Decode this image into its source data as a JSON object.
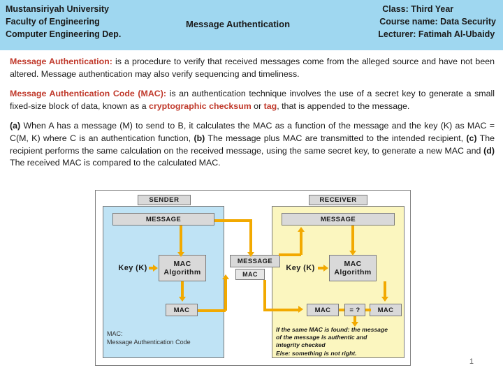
{
  "header": {
    "institution_line1": "Mustansiriyah University",
    "institution_line2": "Faculty of Engineering",
    "institution_line3": "Computer Engineering Dep.",
    "center_title": "Message Authentication",
    "class": "Class: Third Year",
    "course": "Course name: Data Security",
    "lecturer": "Lecturer: Fatimah Al-Ubaidy",
    "background_color": "#9fd7f0"
  },
  "content": {
    "para1": {
      "lead": "Message Authentication:",
      "text": " is a procedure to verify that received messages come from the alleged source and have not been altered. Message authentication may also verify sequencing and timeliness."
    },
    "para2": {
      "lead": "Message Authentication Code (MAC):",
      "text_a": " is an authentication technique involves the use of a secret key to generate a small fixed-size block of data, known as a ",
      "highlight1": "cryptographic checksum",
      "text_b": " or ",
      "highlight2": "tag",
      "text_c": ", that is appended to the message."
    },
    "para3": {
      "label_a": "(a)",
      "text_a": " When A has a message (M) to send to B, it calculates the MAC as a function of the message and the key (K) as MAC = C(M, K) where C is an authentication function, ",
      "label_b": "(b)",
      "text_b": " The message plus MAC are transmitted to the intended recipient, ",
      "label_c": "(c)",
      "text_c": " The recipient performs the same calculation on the received message, using the same secret key, to generate a new MAC and ",
      "label_d": "(d)",
      "text_d": " The received MAC is compared to the calculated MAC."
    }
  },
  "figure": {
    "sender_tag": "SENDER",
    "receiver_tag": "RECEIVER",
    "sender_message": "MESSAGE",
    "receiver_message": "MESSAGE",
    "sender_key": "Key (K)",
    "receiver_key": "Key (K)",
    "sender_algorithm_line1": "MAC",
    "sender_algorithm_line2": "Algorithm",
    "receiver_algorithm_line1": "MAC",
    "receiver_algorithm_line2": "Algorithm",
    "sender_mac": "MAC",
    "transmitted_message": "MESSAGE",
    "transmitted_mac": "MAC",
    "receiver_mac_left": "MAC",
    "receiver_mac_right": "MAC",
    "compare_symbol": "= ?",
    "note_line1": "MAC:",
    "note_line2": "Message Authentication Code",
    "receiver_note_line1": "If the same MAC is found: the message",
    "receiver_note_line2": "of the message is authentic and",
    "receiver_note_line3": "integrity checked",
    "receiver_note_line4": "Else: something is not right.",
    "colors": {
      "sender_panel": "#bfe3f5",
      "receiver_panel": "#fbf6bf",
      "arrow": "#f2a900",
      "box": "#d9d9d9"
    }
  },
  "footer": {
    "page_number": "1"
  }
}
